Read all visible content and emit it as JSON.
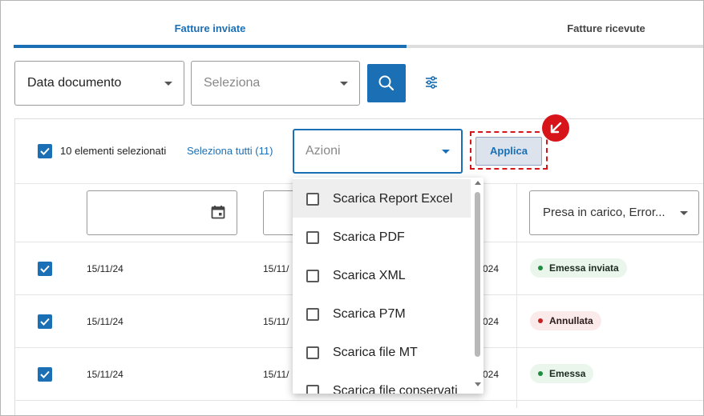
{
  "tabs": {
    "sent": "Fatture inviate",
    "received": "Fatture ricevute"
  },
  "filters": {
    "date_select": "Data documento",
    "value_select": "Seleziona"
  },
  "selection": {
    "count_label": "10 elementi selezionati",
    "select_all": "Seleziona tutti (11)"
  },
  "actions": {
    "placeholder": "Azioni",
    "apply_label": "Applica",
    "options": [
      "Scarica Report Excel",
      "Scarica PDF",
      "Scarica XML",
      "Scarica P7M",
      "Scarica file MT",
      "Scarica file conservati"
    ]
  },
  "table": {
    "status_filter": "Presa in carico, Error...",
    "rows": [
      {
        "date1": "15/11/24",
        "date2": "15/11/",
        "date3": "024",
        "status": "Emessa inviata",
        "status_color": "#1e8e3e"
      },
      {
        "date1": "15/11/24",
        "date2": "15/11/",
        "date3": "024",
        "status": "Annullata",
        "status_color": "#c5221f"
      },
      {
        "date1": "15/11/24",
        "date2": "15/11/",
        "date3": "024",
        "status": "Emessa",
        "status_color": "#1e8e3e"
      }
    ]
  },
  "colors": {
    "primary": "#1a6fb5",
    "highlight": "#d8141b"
  }
}
